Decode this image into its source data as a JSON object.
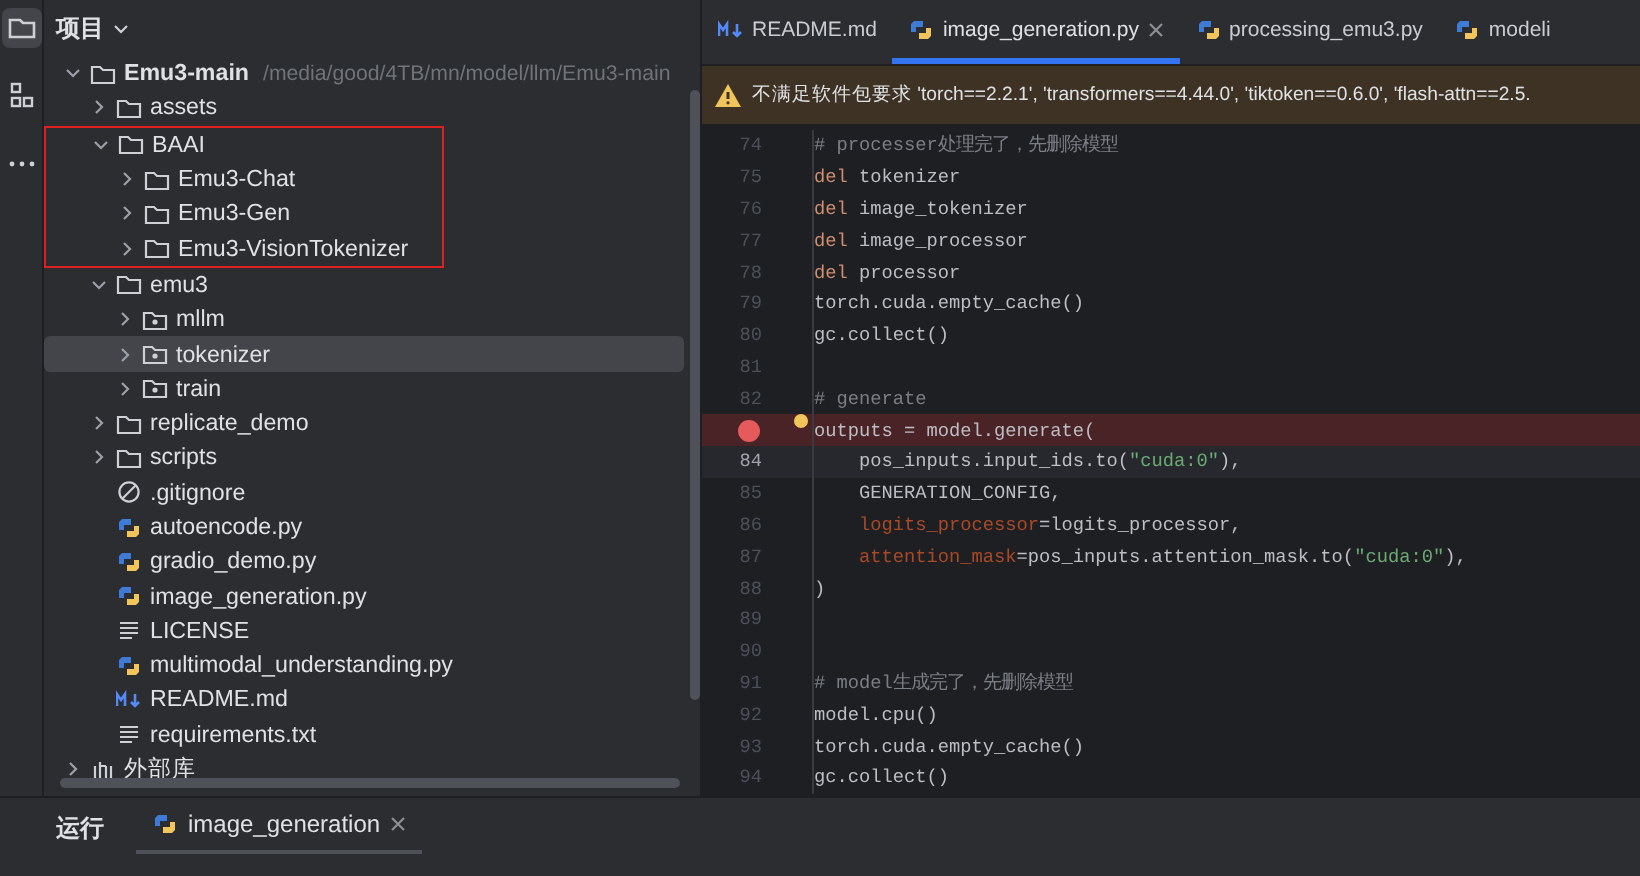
{
  "activity_bar": [
    {
      "kind": "project",
      "selected": true
    },
    {
      "kind": "structure",
      "selected": false
    },
    {
      "kind": "more",
      "selected": false
    }
  ],
  "project_panel": {
    "title": "项目",
    "tree": [
      {
        "label": "Emu3-main",
        "kind": "folder",
        "hint": "/media/good/4TB/mn/model/llm/Emu3-main",
        "expanded": true,
        "selected": false,
        "children": [
          {
            "label": "assets",
            "kind": "folder",
            "expanded": false,
            "selected": false
          },
          {
            "label": "BAAI",
            "kind": "folder",
            "expanded": true,
            "selected": false,
            "annotated": true,
            "children": [
              {
                "label": "Emu3-Chat",
                "kind": "folder",
                "expanded": false,
                "selected": false
              },
              {
                "label": "Emu3-Gen",
                "kind": "folder",
                "expanded": false,
                "selected": false
              },
              {
                "label": "Emu3-VisionTokenizer",
                "kind": "folder",
                "expanded": false,
                "selected": false
              }
            ]
          },
          {
            "label": "emu3",
            "kind": "folder",
            "expanded": true,
            "selected": false,
            "children": [
              {
                "label": "mllm",
                "kind": "package",
                "expanded": false,
                "selected": false
              },
              {
                "label": "tokenizer",
                "kind": "package",
                "expanded": false,
                "selected": true
              },
              {
                "label": "train",
                "kind": "package",
                "expanded": false,
                "selected": false
              }
            ]
          },
          {
            "label": "replicate_demo",
            "kind": "folder",
            "expanded": false,
            "selected": false
          },
          {
            "label": "scripts",
            "kind": "folder",
            "expanded": false,
            "selected": false
          },
          {
            "label": ".gitignore",
            "kind": "ignore",
            "selected": false
          },
          {
            "label": "autoencode.py",
            "kind": "python",
            "selected": false
          },
          {
            "label": "gradio_demo.py",
            "kind": "python",
            "selected": false
          },
          {
            "label": "image_generation.py",
            "kind": "python",
            "selected": false
          },
          {
            "label": "LICENSE",
            "kind": "text",
            "selected": false
          },
          {
            "label": "multimodal_understanding.py",
            "kind": "python",
            "selected": false
          },
          {
            "label": "README.md",
            "kind": "markdown",
            "selected": false
          },
          {
            "label": "requirements.txt",
            "kind": "text",
            "selected": false
          }
        ]
      },
      {
        "label": "外部库",
        "kind": "library",
        "expanded": false,
        "selected": false
      }
    ]
  },
  "editor_tabs": [
    {
      "label": "README.md",
      "kind": "markdown",
      "selected": false,
      "close": false
    },
    {
      "label": "image_generation.py",
      "kind": "python",
      "selected": true,
      "close": true
    },
    {
      "label": "processing_emu3.py",
      "kind": "python",
      "selected": false,
      "close": false
    },
    {
      "label": "modeli",
      "kind": "python",
      "selected": false,
      "close": false
    }
  ],
  "warning": {
    "text": "不满足软件包要求 'torch==2.2.1', 'transformers==4.44.0', 'tiktoken==0.6.0', 'flash-attn==2.5."
  },
  "code_lines": [
    {
      "number": "74",
      "breakpoint": false,
      "current": false,
      "tokens": [
        {
          "kind": "comment",
          "text": "# processer处理完了，先删除模型"
        }
      ]
    },
    {
      "number": "75",
      "breakpoint": false,
      "current": false,
      "tokens": [
        {
          "kind": "keyword",
          "text": "del"
        },
        {
          "kind": "plain",
          "text": " tokenizer"
        }
      ]
    },
    {
      "number": "76",
      "breakpoint": false,
      "current": false,
      "tokens": [
        {
          "kind": "keyword",
          "text": "del"
        },
        {
          "kind": "plain",
          "text": " image_tokenizer"
        }
      ]
    },
    {
      "number": "77",
      "breakpoint": false,
      "current": false,
      "tokens": [
        {
          "kind": "keyword",
          "text": "del"
        },
        {
          "kind": "plain",
          "text": " image_processor"
        }
      ]
    },
    {
      "number": "78",
      "breakpoint": false,
      "current": false,
      "tokens": [
        {
          "kind": "keyword",
          "text": "del"
        },
        {
          "kind": "plain",
          "text": " processor"
        }
      ]
    },
    {
      "number": "79",
      "breakpoint": false,
      "current": false,
      "tokens": [
        {
          "kind": "plain",
          "text": "torch.cuda.empty_cache()"
        }
      ]
    },
    {
      "number": "80",
      "breakpoint": false,
      "current": false,
      "tokens": [
        {
          "kind": "plain",
          "text": "gc.collect()"
        }
      ]
    },
    {
      "number": "81",
      "breakpoint": false,
      "current": false
    },
    {
      "number": "82",
      "breakpoint": false,
      "current": false,
      "tokens": [
        {
          "kind": "comment",
          "text": "# generate"
        }
      ]
    },
    {
      "breakpoint": true,
      "current": false,
      "tokens": [
        {
          "kind": "plain",
          "text": "outputs = model.generate("
        }
      ]
    },
    {
      "number": "84",
      "breakpoint": false,
      "current": true,
      "tokens": [
        {
          "kind": "plain",
          "text": "    pos_inputs.input_ids.to("
        },
        {
          "kind": "string",
          "text": "\"cuda:0\""
        },
        {
          "kind": "plain",
          "text": "),"
        }
      ]
    },
    {
      "number": "85",
      "breakpoint": false,
      "current": false,
      "tokens": [
        {
          "kind": "plain",
          "text": "    GENERATION_CONFIG,"
        }
      ]
    },
    {
      "number": "86",
      "breakpoint": false,
      "current": false,
      "tokens": [
        {
          "kind": "param",
          "text": "    logits_processor"
        },
        {
          "kind": "plain",
          "text": "=logits_processor,"
        }
      ]
    },
    {
      "number": "87",
      "breakpoint": false,
      "current": false,
      "tokens": [
        {
          "kind": "param",
          "text": "    attention_mask"
        },
        {
          "kind": "plain",
          "text": "=pos_inputs.attention_mask.to("
        },
        {
          "kind": "string",
          "text": "\"cuda:0\""
        },
        {
          "kind": "plain",
          "text": "),"
        }
      ]
    },
    {
      "number": "88",
      "breakpoint": false,
      "current": false,
      "tokens": [
        {
          "kind": "plain",
          "text": ")"
        }
      ]
    },
    {
      "number": "89",
      "breakpoint": false,
      "current": false
    },
    {
      "number": "90",
      "breakpoint": false,
      "current": false
    },
    {
      "number": "91",
      "breakpoint": false,
      "current": false,
      "tokens": [
        {
          "kind": "comment",
          "text": "# model生成完了，先删除模型"
        }
      ]
    },
    {
      "number": "92",
      "breakpoint": false,
      "current": false,
      "tokens": [
        {
          "kind": "plain",
          "text": "model.cpu()"
        }
      ]
    },
    {
      "number": "93",
      "breakpoint": false,
      "current": false,
      "tokens": [
        {
          "kind": "plain",
          "text": "torch.cuda.empty_cache()"
        }
      ]
    },
    {
      "number": "94",
      "breakpoint": false,
      "current": false,
      "tokens": [
        {
          "kind": "plain",
          "text": "gc.collect()"
        }
      ]
    }
  ],
  "run_panel": {
    "title": "运行",
    "tabs": [
      {
        "label": "image_generation",
        "kind": "python",
        "selected": true,
        "close": true
      }
    ]
  }
}
